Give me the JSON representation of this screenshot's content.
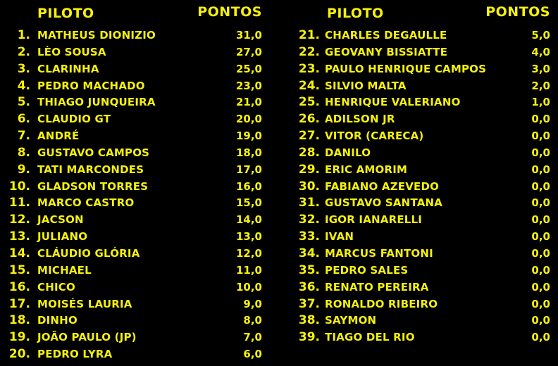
{
  "headers": {
    "left_pilot": "PILOTO",
    "left_points": "PONTOS",
    "right_pilot": "PILOTO",
    "right_points": "PONTOS"
  },
  "colors": {
    "background": "#000000",
    "text": "#f5f10a"
  },
  "left": [
    {
      "pos": "1.",
      "name": "MATHEUS DIONIZIO",
      "points": "31,0"
    },
    {
      "pos": "2.",
      "name": "LÈO SOUSA",
      "points": "27,0"
    },
    {
      "pos": "3.",
      "name": "CLARINHA",
      "points": "25,0"
    },
    {
      "pos": "4.",
      "name": "PEDRO MACHADO",
      "points": "23,0"
    },
    {
      "pos": "5.",
      "name": "THIAGO JUNQUEIRA",
      "points": "21,0"
    },
    {
      "pos": "6.",
      "name": "CLAUDIO GT",
      "points": "20,0"
    },
    {
      "pos": "7.",
      "name": "ANDRÉ",
      "points": "19,0"
    },
    {
      "pos": "8.",
      "name": "GUSTAVO CAMPOS",
      "points": "18,0"
    },
    {
      "pos": "9.",
      "name": "TATI MARCONDES",
      "points": "17,0"
    },
    {
      "pos": "10.",
      "name": "GLADSON TORRES",
      "points": "16,0"
    },
    {
      "pos": "11.",
      "name": "MARCO CASTRO",
      "points": "15,0"
    },
    {
      "pos": "12.",
      "name": "JACSON",
      "points": "14,0"
    },
    {
      "pos": "13.",
      "name": "JULIANO",
      "points": "13,0"
    },
    {
      "pos": "14.",
      "name": "CLÁUDIO GLÓRIA",
      "points": "12,0"
    },
    {
      "pos": "15.",
      "name": "MICHAEL",
      "points": "11,0"
    },
    {
      "pos": "16.",
      "name": "CHICO",
      "points": "10,0"
    },
    {
      "pos": "17.",
      "name": "MOISÉS LAURIA",
      "points": "9,0"
    },
    {
      "pos": "18.",
      "name": "DINHO",
      "points": "8,0"
    },
    {
      "pos": "19.",
      "name": "JOÃO PAULO (JP)",
      "points": "7,0"
    },
    {
      "pos": "20.",
      "name": "PEDRO LYRA",
      "points": "6,0"
    }
  ],
  "right": [
    {
      "pos": "21.",
      "name": "CHARLES DEGAULLE",
      "points": "5,0"
    },
    {
      "pos": "22.",
      "name": "GEOVANY BISSIATTE",
      "points": "4,0"
    },
    {
      "pos": "23.",
      "name": "PAULO HENRIQUE CAMPOS",
      "points": "3,0"
    },
    {
      "pos": "24.",
      "name": "SILVIO MALTA",
      "points": "2,0"
    },
    {
      "pos": "25.",
      "name": "HENRIQUE VALERIANO",
      "points": "1,0"
    },
    {
      "pos": "26.",
      "name": "ADILSON JR",
      "points": "0,0"
    },
    {
      "pos": "27.",
      "name": "VITOR (CARECA)",
      "points": "0,0"
    },
    {
      "pos": "28.",
      "name": "DANILO",
      "points": "0,0"
    },
    {
      "pos": "29.",
      "name": "ERIC AMORIM",
      "points": "0,0"
    },
    {
      "pos": "30.",
      "name": "FABIANO AZEVEDO",
      "points": "0,0"
    },
    {
      "pos": "31.",
      "name": "GUSTAVO SANTANA",
      "points": "0,0"
    },
    {
      "pos": "32.",
      "name": "IGOR IANARELLI",
      "points": "0,0"
    },
    {
      "pos": "33.",
      "name": "IVAN",
      "points": "0,0"
    },
    {
      "pos": "34.",
      "name": "MARCUS FANTONI",
      "points": "0,0"
    },
    {
      "pos": "35.",
      "name": "PEDRO SALES",
      "points": "0,0"
    },
    {
      "pos": "36.",
      "name": "RENATO PEREIRA",
      "points": "0,0"
    },
    {
      "pos": "37.",
      "name": "RONALDO RIBEIRO",
      "points": "0,0"
    },
    {
      "pos": "38.",
      "name": "SAYMON",
      "points": "0,0"
    },
    {
      "pos": "39.",
      "name": "TIAGO DEL RIO",
      "points": "0,0"
    }
  ]
}
